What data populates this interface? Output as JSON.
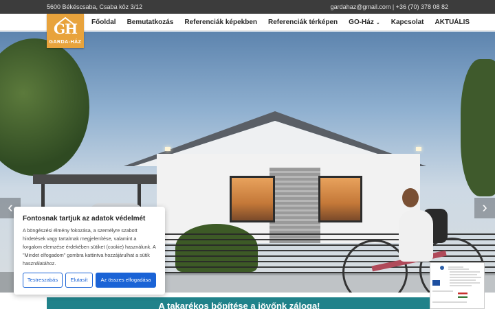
{
  "topbar": {
    "address": "5600 Békéscsaba, Csaba köz 3/12",
    "contact": "gardahaz@gmail.com | +36 (70) 378 08 82"
  },
  "logo": {
    "monogram": "GH",
    "name": "GARDA-HÁZ"
  },
  "nav": {
    "items": [
      {
        "label": "Főoldal"
      },
      {
        "label": "Bemutatkozás"
      },
      {
        "label": "Referenciák képekben"
      },
      {
        "label": "Referenciák térképen"
      },
      {
        "label": "GO-Ház",
        "has_dropdown": true
      },
      {
        "label": "Kapcsolat"
      },
      {
        "label": "AKTUÁLIS"
      }
    ]
  },
  "hero": {
    "prev_icon": "chevron-left-icon",
    "next_icon": "chevron-right-icon"
  },
  "cookie": {
    "title": "Fontosnak tartjuk az adatok védelmét",
    "text": "A böngészési élmény fokozása, a személyre szabott hirdetések vagy tartalmak megjelenítése, valamint a forgalom elemzése érdekében sütiket (cookie) használunk. A \"Mindet elfogadom\" gombra kattintva hozzájárulhat a sütik használatához.",
    "customize_label": "Testreszabás",
    "reject_label": "Elutasít",
    "accept_label": "Az összes elfogadása"
  },
  "banner": {
    "text": "A takarékos bőpítése a jövőnk záloga!"
  },
  "colors": {
    "topbar": "#3c3c3c",
    "logo": "#e8a33c",
    "accent_blue": "#1a63d6",
    "teal": "#20828a"
  }
}
